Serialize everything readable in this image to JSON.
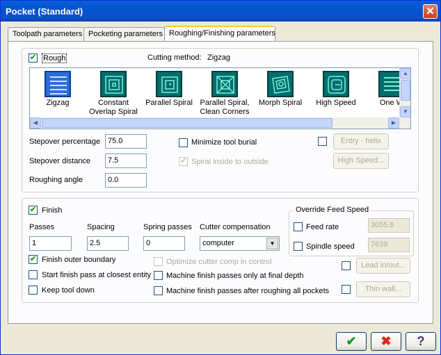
{
  "window": {
    "title": "Pocket (Standard)",
    "close": "✕"
  },
  "tabs": [
    {
      "label": "Toolpath parameters"
    },
    {
      "label": "Pocketing parameters"
    },
    {
      "label": "Roughing/Finishing parameters"
    }
  ],
  "rough": {
    "label": "Rough",
    "checked": "✔",
    "cutting_method_label": "Cutting method:",
    "cutting_method_value": "Zigzag",
    "patterns": [
      {
        "label": "Zigzag",
        "icon": "zigzag-pattern-icon"
      },
      {
        "label": "Constant Overlap Spiral",
        "icon": "constant-overlap-spiral-icon"
      },
      {
        "label": "Parallel Spiral",
        "icon": "parallel-spiral-icon"
      },
      {
        "label": "Parallel Spiral, Clean Corners",
        "icon": "parallel-spiral-clean-corners-icon"
      },
      {
        "label": "Morph Spiral",
        "icon": "morph-spiral-icon"
      },
      {
        "label": "High Speed",
        "icon": "high-speed-icon"
      },
      {
        "label": "One W",
        "icon": "one-way-icon"
      }
    ],
    "stepover_pct_label": "Stepover percentage",
    "stepover_pct": "75.0",
    "stepover_dist_label": "Stepover distance",
    "stepover_dist": "7.5",
    "angle_label": "Roughing angle",
    "angle": "0.0",
    "minimize_burial_label": "Minimize tool burial",
    "spiral_inside_label": "Spiral inside to outside",
    "spiral_inside_checked": "✔",
    "entry_helix_label": "Entry - helix",
    "high_speed_label": "High Speed..."
  },
  "finish": {
    "label": "Finish",
    "checked": "✔",
    "passes_label": "Passes",
    "passes": "1",
    "spacing_label": "Spacing",
    "spacing": "2.5",
    "spring_label": "Spring passes",
    "spring": "0",
    "comp_label": "Cutter compensation",
    "comp_value": "computer",
    "outer_boundary_label": "Finish outer boundary",
    "outer_boundary_checked": "✔",
    "start_closest_label": "Start finish pass at closest entity",
    "keep_tool_down_label": "Keep tool down",
    "optimize_comp_label": "Optimize cutter comp in control",
    "final_depth_label": "Machine finish passes only at final depth",
    "after_roughing_label": "Machine finish passes after roughing all pockets",
    "override_legend": "Override Feed Speed",
    "feed_rate_label": "Feed rate",
    "feed_rate": "3055.6",
    "spindle_label": "Spindle speed",
    "spindle": "7639",
    "lead_label": "Lead in/out...",
    "thin_wall_label": "Thin wall..."
  },
  "footer": {
    "ok": "✔",
    "cancel": "✖",
    "help": "?"
  },
  "colors": {
    "title_bar": "#0453d1",
    "ok_check": "#1f9a1f",
    "cancel_x": "#e0251b"
  }
}
